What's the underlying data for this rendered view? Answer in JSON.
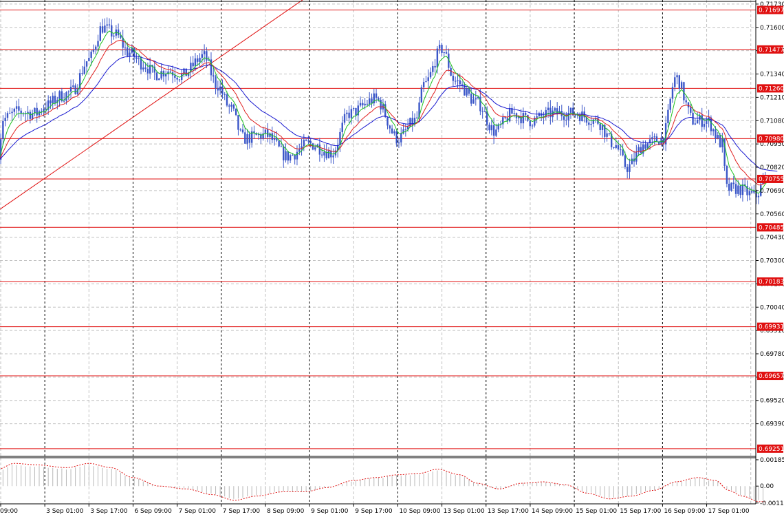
{
  "colors": {
    "background": "#ffffff",
    "grid": "#c0c0c0",
    "candle": "#3a56c8",
    "ma_fast": "#1fc21f",
    "ma_mid": "#e02020",
    "ma_slow": "#1a1ad0",
    "level_line": "#e01010",
    "level_label_bg": "#e01010",
    "trendline": "#e01010",
    "osc_line": "#e01010",
    "osc_hist": "#b8b8b8"
  },
  "chart_data": {
    "type": "line",
    "title": "",
    "xlabel": "",
    "ylabel": "",
    "ylim": [
      0.69212,
      0.71745
    ],
    "y_ticks": [
      "0.71730",
      "0.71600",
      "0.71470",
      "0.71340",
      "0.71210",
      "0.71080",
      "0.70950",
      "0.70820",
      "0.70690",
      "0.70560",
      "0.70430",
      "0.70300",
      "0.70170",
      "0.70040",
      "0.69910",
      "0.69780",
      "0.69650",
      "0.69520",
      "0.69390"
    ],
    "x_labels": [
      "09:00",
      "3 Sep 01:00",
      "3 Sep 17:00",
      "6 Sep 09:00",
      "7 Sep 01:00",
      "7 Sep 17:00",
      "8 Sep 09:00",
      "9 Sep 01:00",
      "9 Sep 17:00",
      "10 Sep 09:00",
      "13 Sep 01:00",
      "13 Sep 17:00",
      "14 Sep 09:00",
      "15 Sep 01:00",
      "15 Sep 17:00",
      "16 Sep 09:00",
      "17 Sep 01:00"
    ],
    "x_day_separators": [
      1,
      3,
      5,
      7,
      9,
      11,
      13,
      15
    ],
    "grid": true,
    "levels": [
      {
        "value": 0.71697,
        "label": "0.71697"
      },
      {
        "value": 0.71477,
        "label": "0.71477"
      },
      {
        "value": 0.7126,
        "label": "0.71260"
      },
      {
        "value": 0.7098,
        "label": "0.70980"
      },
      {
        "value": 0.70755,
        "label": "0.70755"
      },
      {
        "value": 0.70485,
        "label": "0.70485"
      },
      {
        "value": 0.70183,
        "label": "0.70183"
      },
      {
        "value": 0.69931,
        "label": "0.69931"
      },
      {
        "value": 0.69657,
        "label": "0.69657"
      },
      {
        "value": 0.69251,
        "label": "0.69251"
      }
    ],
    "trendline": {
      "from": [
        -0.05,
        0.7058
      ],
      "to": [
        7.0,
        0.7178
      ]
    },
    "price_anchors": [
      [
        -0.05,
        0.709
      ],
      [
        0.05,
        0.7109
      ],
      [
        0.4,
        0.7113
      ],
      [
        0.8,
        0.7112
      ],
      [
        1.0,
        0.7116
      ],
      [
        1.4,
        0.7122
      ],
      [
        1.6,
        0.7124
      ],
      [
        2.0,
        0.7142
      ],
      [
        2.3,
        0.716
      ],
      [
        2.6,
        0.7156
      ],
      [
        2.9,
        0.7146
      ],
      [
        3.2,
        0.714
      ],
      [
        3.5,
        0.7134
      ],
      [
        3.8,
        0.7136
      ],
      [
        4.1,
        0.7133
      ],
      [
        4.6,
        0.7144
      ],
      [
        4.9,
        0.7128
      ],
      [
        5.2,
        0.7115
      ],
      [
        5.5,
        0.7098
      ],
      [
        6.0,
        0.71
      ],
      [
        6.5,
        0.7088
      ],
      [
        7.0,
        0.7095
      ],
      [
        7.5,
        0.709
      ],
      [
        7.9,
        0.7112
      ],
      [
        8.5,
        0.712
      ],
      [
        9.0,
        0.7098
      ],
      [
        9.4,
        0.7108
      ],
      [
        9.6,
        0.7128
      ],
      [
        10.0,
        0.7148
      ],
      [
        10.3,
        0.713
      ],
      [
        10.8,
        0.7118
      ],
      [
        11.2,
        0.7102
      ],
      [
        11.6,
        0.7112
      ],
      [
        12.0,
        0.7108
      ],
      [
        12.5,
        0.7112
      ],
      [
        13.0,
        0.7112
      ],
      [
        13.5,
        0.7108
      ],
      [
        13.9,
        0.7095
      ],
      [
        14.2,
        0.7082
      ],
      [
        14.6,
        0.7095
      ],
      [
        15.0,
        0.7098
      ],
      [
        15.3,
        0.7132
      ],
      [
        15.7,
        0.7108
      ],
      [
        16.0,
        0.7108
      ],
      [
        16.35,
        0.7095
      ],
      [
        16.45,
        0.707
      ],
      [
        16.7,
        0.707
      ],
      [
        17.1,
        0.7066
      ],
      [
        17.35,
        0.7076
      ]
    ],
    "series": [
      {
        "name": "",
        "role": "price_candles",
        "values": []
      },
      {
        "name": "",
        "role": "ma_fast",
        "period_bars": 6
      },
      {
        "name": "",
        "role": "ma_mid",
        "period_bars": 14
      },
      {
        "name": "",
        "role": "ma_slow",
        "period_bars": 30
      }
    ],
    "oscillator": {
      "y_ticks": [
        "0.001855",
        "0.00",
        "-0.00119"
      ],
      "ylim": [
        -0.00125,
        0.00195
      ],
      "anchors": [
        [
          -0.05,
          0.0012
        ],
        [
          0.3,
          0.0016
        ],
        [
          0.8,
          0.0015
        ],
        [
          1.5,
          0.0013
        ],
        [
          2.0,
          0.0016
        ],
        [
          2.5,
          0.0013
        ],
        [
          3.0,
          0.0006
        ],
        [
          3.6,
          0.0
        ],
        [
          4.2,
          -0.0002
        ],
        [
          4.8,
          -0.0006
        ],
        [
          5.3,
          -0.001
        ],
        [
          5.8,
          -0.0007
        ],
        [
          6.4,
          -0.0004
        ],
        [
          6.9,
          -0.0004
        ],
        [
          7.4,
          -0.0001
        ],
        [
          8.0,
          0.0004
        ],
        [
          8.5,
          0.0006
        ],
        [
          9.0,
          0.0008
        ],
        [
          9.5,
          0.0009
        ],
        [
          9.9,
          0.0012
        ],
        [
          10.4,
          0.0008
        ],
        [
          10.8,
          0.0002
        ],
        [
          11.3,
          -0.0002
        ],
        [
          11.8,
          0.0002
        ],
        [
          12.3,
          0.0003
        ],
        [
          12.8,
          0.0001
        ],
        [
          13.3,
          -0.0005
        ],
        [
          13.8,
          -0.0009
        ],
        [
          14.3,
          -0.0007
        ],
        [
          14.8,
          -0.0003
        ],
        [
          15.3,
          0.0003
        ],
        [
          15.8,
          0.0006
        ],
        [
          16.2,
          0.0004
        ],
        [
          16.5,
          -0.0003
        ],
        [
          16.8,
          -0.0007
        ],
        [
          17.2,
          -0.0011
        ],
        [
          17.4,
          -0.0011
        ]
      ]
    }
  }
}
